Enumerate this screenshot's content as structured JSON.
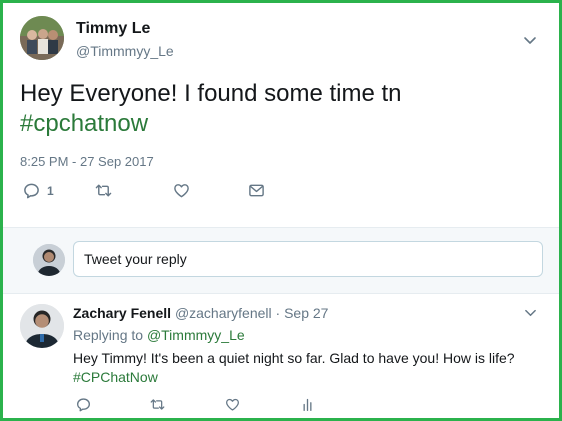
{
  "tweet": {
    "author_name": "Timmy Le",
    "author_handle": "@Timmmyy_Le",
    "text_main": "Hey Everyone! I found some time tn",
    "hashtag": "#cpchatnow",
    "timestamp": "8:25 PM - 27 Sep 2017",
    "reply_count": "1",
    "icons": [
      "chevron-down-icon",
      "reply-icon",
      "retweet-icon",
      "like-icon",
      "message-icon"
    ]
  },
  "composer": {
    "placeholder": "Tweet your reply"
  },
  "reply_tweet": {
    "author_name": "Zachary Fenell",
    "author_meta": "@zacharyfenell · Sep 27",
    "replying_label": "Replying to",
    "replying_handle": "@Timmmyy_Le",
    "text": "Hey Timmy! It's been a quiet night so far. Glad to have you! How is life?",
    "hashtag": "#CPChatNow",
    "icons": [
      "reply-icon",
      "retweet-icon",
      "like-icon",
      "analytics-icon"
    ]
  },
  "colors": {
    "frame_border": "#2bb24c",
    "hashtag": "#2b7a3a",
    "muted_text": "#657786",
    "composer_bg": "#f5f8fa"
  }
}
